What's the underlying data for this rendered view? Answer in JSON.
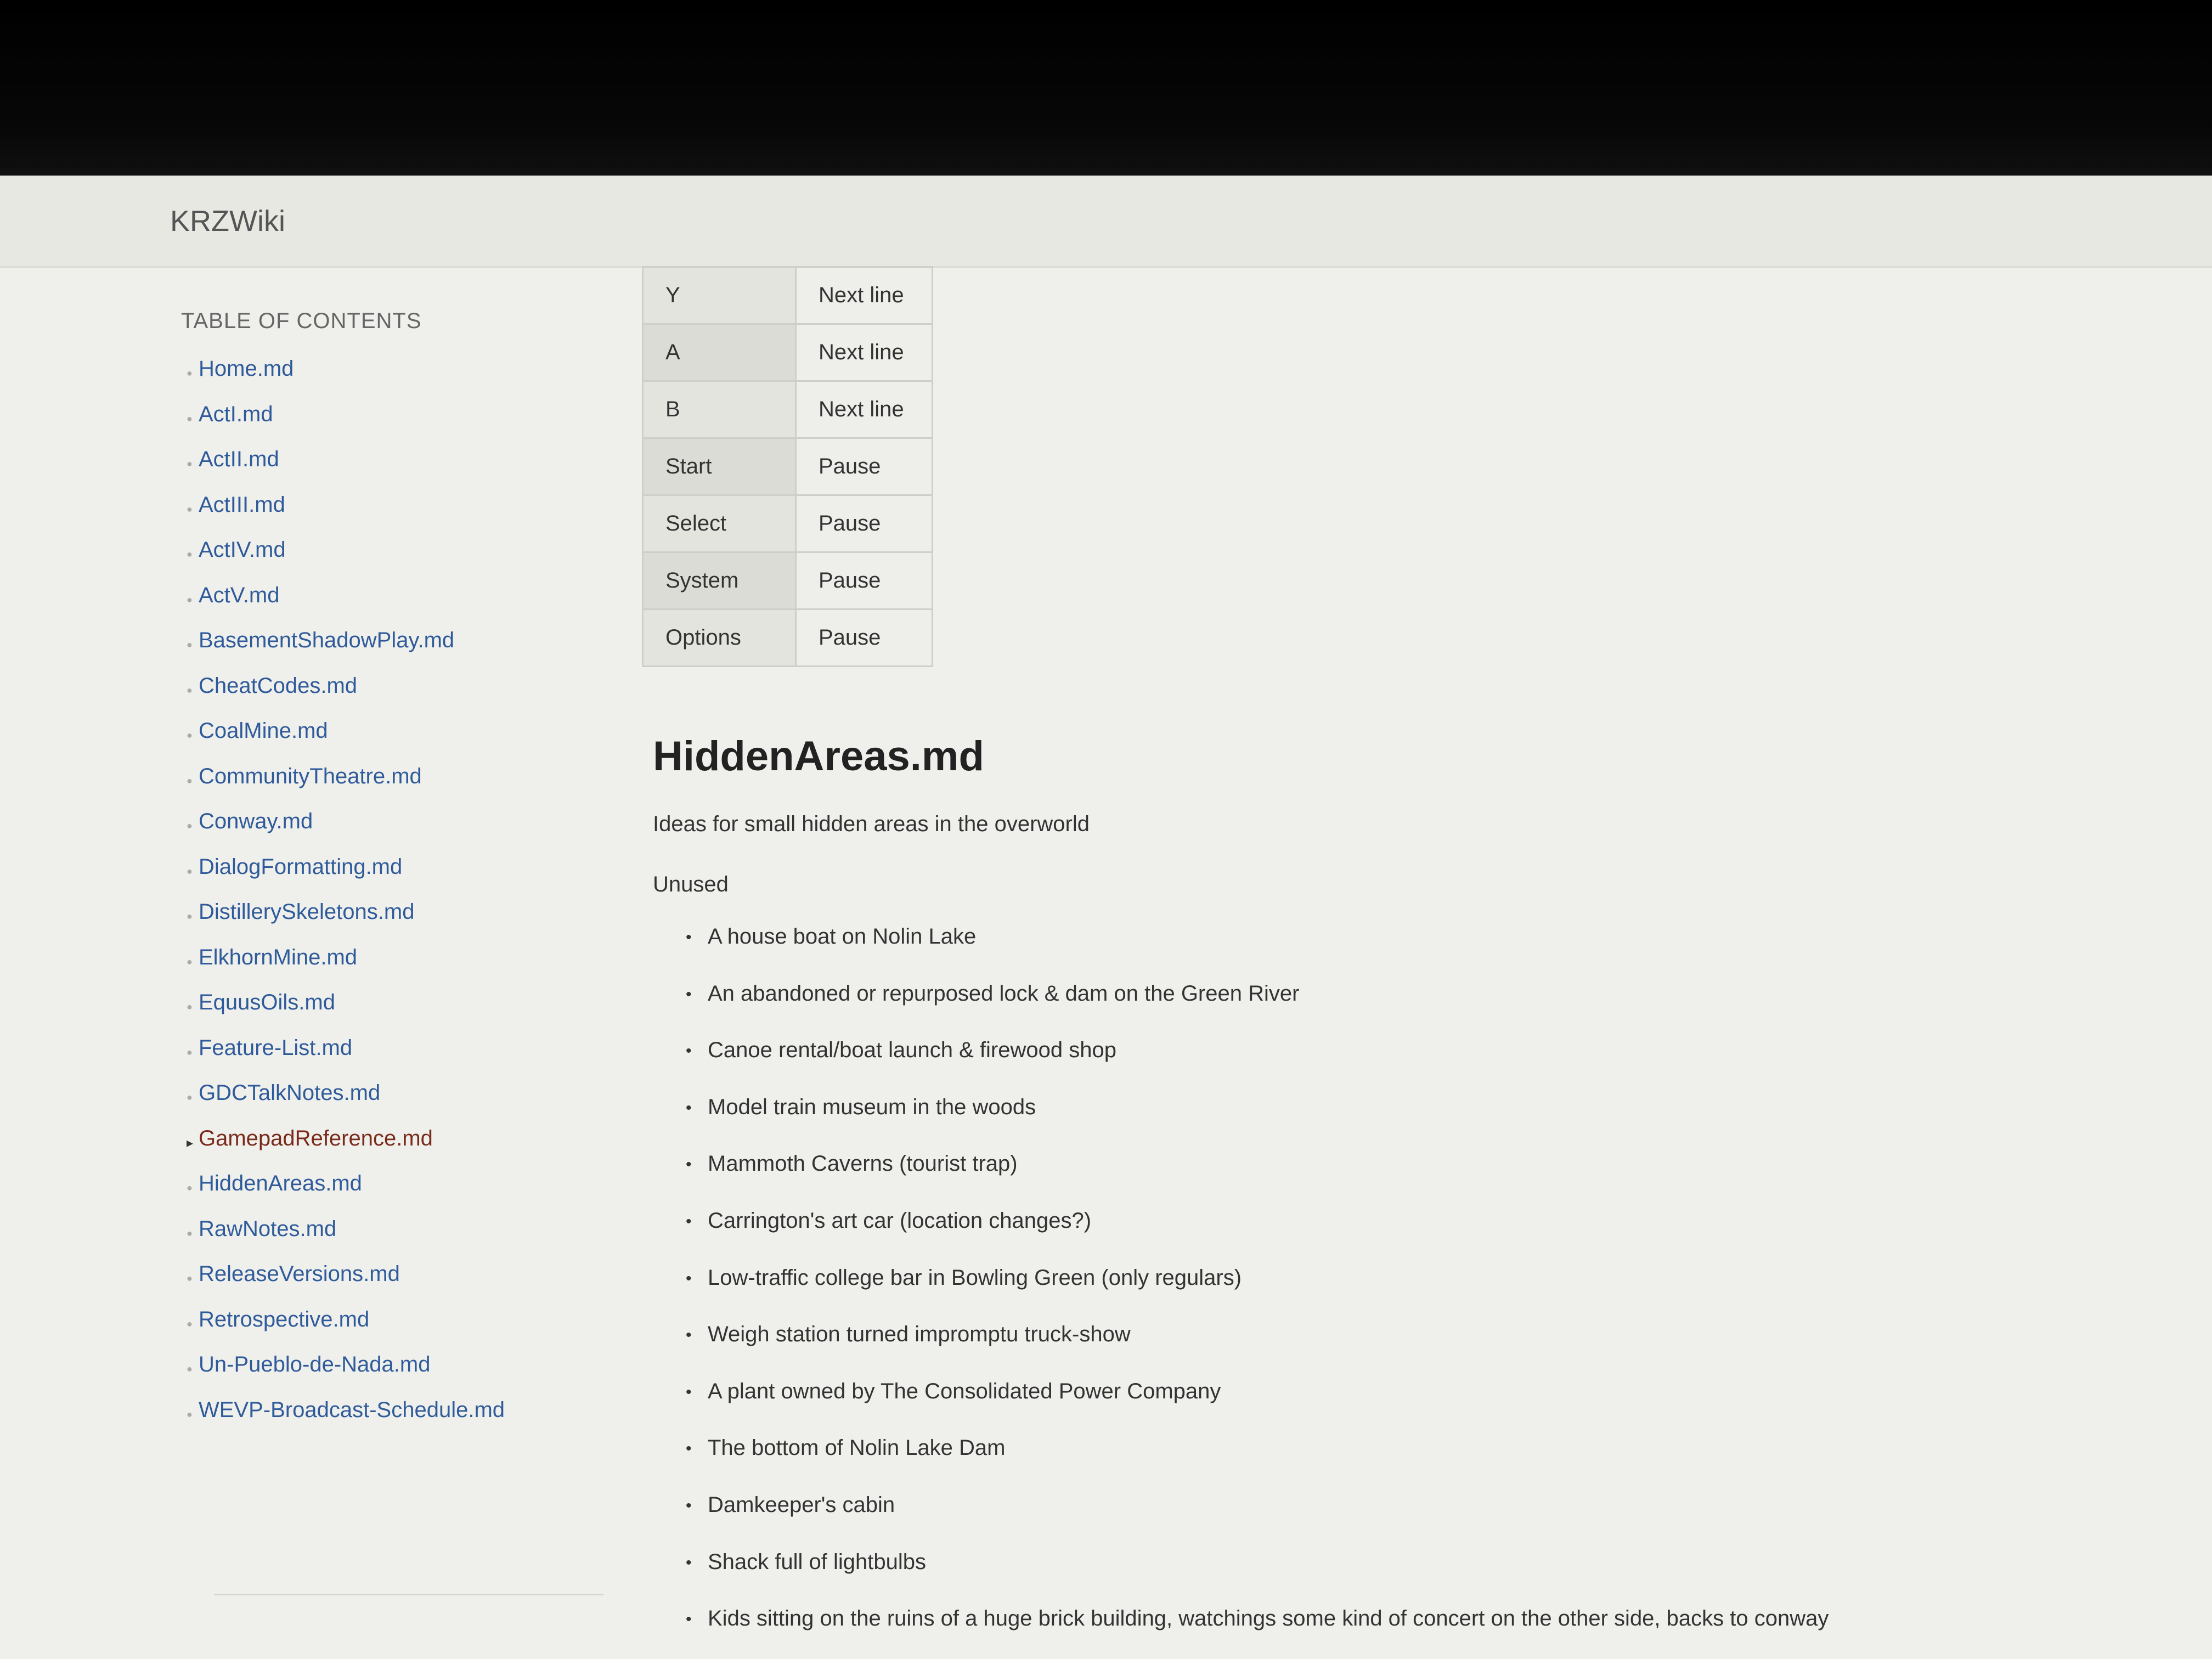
{
  "header": {
    "brand": "KRZWiki"
  },
  "sidebar": {
    "toc_title": "TABLE OF CONTENTS",
    "items": [
      {
        "label": "Home.md"
      },
      {
        "label": "ActI.md"
      },
      {
        "label": "ActII.md"
      },
      {
        "label": "ActIII.md"
      },
      {
        "label": "ActIV.md"
      },
      {
        "label": "ActV.md"
      },
      {
        "label": "BasementShadowPlay.md"
      },
      {
        "label": "CheatCodes.md"
      },
      {
        "label": "CoalMine.md"
      },
      {
        "label": "CommunityTheatre.md"
      },
      {
        "label": "Conway.md"
      },
      {
        "label": "DialogFormatting.md"
      },
      {
        "label": "DistillerySkeletons.md"
      },
      {
        "label": "ElkhornMine.md"
      },
      {
        "label": "EquusOils.md"
      },
      {
        "label": "Feature-List.md"
      },
      {
        "label": "GDCTalkNotes.md"
      },
      {
        "label": "GamepadReference.md",
        "active": true
      },
      {
        "label": "HiddenAreas.md"
      },
      {
        "label": "RawNotes.md"
      },
      {
        "label": "ReleaseVersions.md"
      },
      {
        "label": "Retrospective.md"
      },
      {
        "label": "Un-Pueblo-de-Nada.md"
      },
      {
        "label": "WEVP-Broadcast-Schedule.md"
      }
    ]
  },
  "controls_table": {
    "rows": [
      {
        "button": "Y",
        "action": "Next line"
      },
      {
        "button": "A",
        "action": "Next line"
      },
      {
        "button": "B",
        "action": "Next line"
      },
      {
        "button": "Start",
        "action": "Pause"
      },
      {
        "button": "Select",
        "action": "Pause"
      },
      {
        "button": "System",
        "action": "Pause"
      },
      {
        "button": "Options",
        "action": "Pause"
      }
    ]
  },
  "main": {
    "title": "HiddenAreas.md",
    "intro": "Ideas for small hidden areas in the overworld",
    "section_label": "Unused",
    "bullets": [
      "A house boat on Nolin Lake",
      "An abandoned or repurposed lock & dam on the Green River",
      "Canoe rental/boat launch & firewood shop",
      "Model train museum in the woods",
      "Mammoth Caverns (tourist trap)",
      "Carrington's art car (location changes?)",
      "Low-traffic college bar in Bowling Green (only regulars)",
      "Weigh station turned impromptu truck-show",
      "A plant owned by The Consolidated Power Company",
      "The bottom of Nolin Lake Dam",
      "Damkeeper's cabin",
      "Shack full of lightbulbs",
      "Kids sitting on the ruins of a huge brick building, watchings some kind of concert on the other side, backs to conway"
    ]
  }
}
